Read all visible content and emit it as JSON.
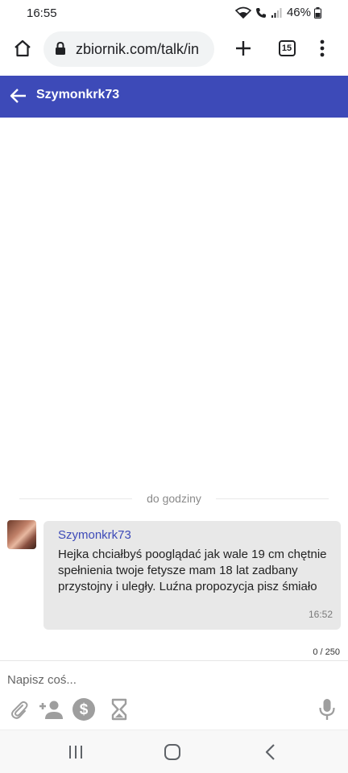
{
  "status_bar": {
    "time": "16:55",
    "battery": "46%"
  },
  "browser": {
    "url": "zbiornik.com/talk/in",
    "tab_count": "15"
  },
  "header": {
    "title": "Szymonkrk73"
  },
  "chat": {
    "divider": "do godziny",
    "messages": [
      {
        "sender": "Szymonkrk73",
        "text": "Hejka chciałbyś pooglądać jak wale 19 cm chętnie spełnienia twoje fetysze mam 18 lat zadbany przystojny i uległy. Luźna propozycja pisz śmiało",
        "time": "16:52"
      }
    ]
  },
  "composer": {
    "char_count": "0 / 250",
    "placeholder": "Napisz coś..."
  },
  "icons": {
    "status": [
      "wifi-icon",
      "call-icon",
      "signal-icon",
      "battery-icon"
    ],
    "toolbar": [
      "attach-icon",
      "add-person-icon",
      "dollar-icon",
      "hourglass-icon",
      "mic-icon"
    ],
    "nav": [
      "recent-apps-icon",
      "home-icon",
      "back-icon"
    ]
  },
  "colors": {
    "accent": "#3d4ab8",
    "bubble": "#e8e8e8",
    "icon_grey": "#9e9e9e"
  }
}
